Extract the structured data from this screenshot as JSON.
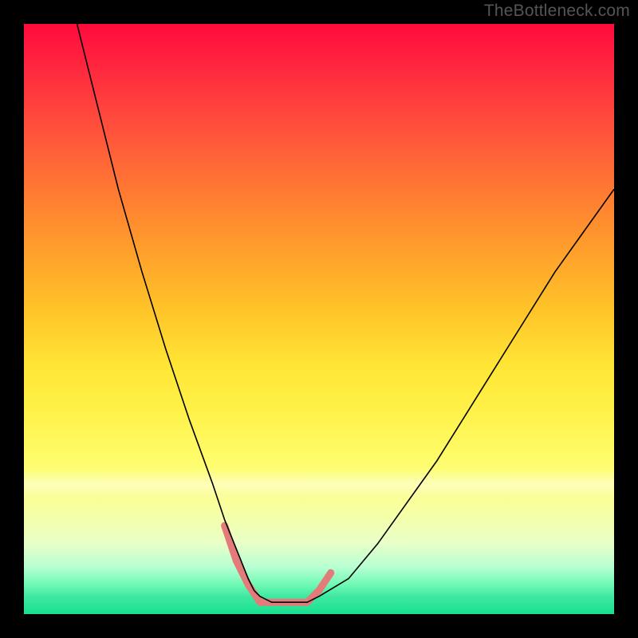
{
  "watermark": "TheBottleneck.com",
  "chart_data": {
    "type": "line",
    "title": "",
    "xlabel": "",
    "ylabel": "",
    "xlim": [
      0,
      100
    ],
    "ylim": [
      0,
      100
    ],
    "grid": false,
    "legend": false,
    "background_gradient": {
      "direction": "vertical",
      "stops": [
        {
          "pos": 0.0,
          "color": "#ff0a3c"
        },
        {
          "pos": 0.2,
          "color": "#ff5a3a"
        },
        {
          "pos": 0.5,
          "color": "#ffe635"
        },
        {
          "pos": 0.8,
          "color": "#f8ffa0"
        },
        {
          "pos": 1.0,
          "color": "#17e08f"
        }
      ]
    },
    "series": [
      {
        "name": "main-curve",
        "color": "#000000",
        "stroke_width": 1.6,
        "x": [
          9,
          12,
          16,
          20,
          24,
          28,
          32,
          34,
          36,
          38,
          39,
          40,
          42,
          45,
          48,
          50,
          55,
          60,
          65,
          70,
          75,
          80,
          85,
          90,
          95,
          100
        ],
        "y": [
          100,
          88,
          72,
          58,
          45,
          33,
          22,
          16,
          11,
          6,
          4,
          3,
          2,
          2,
          2,
          3,
          6,
          12,
          19,
          26,
          34,
          42,
          50,
          58,
          65,
          72
        ]
      },
      {
        "name": "bottom-highlight",
        "color": "#e37b7b",
        "stroke_width": 9,
        "stroke_linecap": "round",
        "x": [
          34,
          36,
          38,
          40,
          42,
          45,
          48,
          50,
          52
        ],
        "y": [
          15,
          9,
          5,
          2,
          2,
          2,
          2,
          4,
          7
        ]
      }
    ]
  }
}
